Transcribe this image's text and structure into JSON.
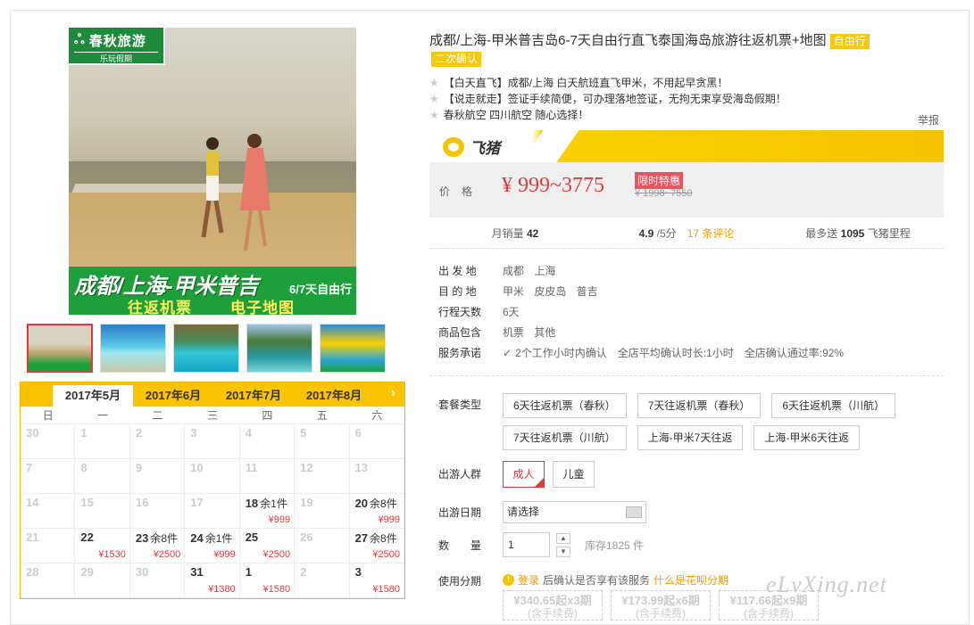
{
  "title": "成都/上海-甲米普吉岛6-7天自由行直飞泰国海岛旅游往返机票+地图",
  "tag_free": "自由行",
  "tag_confirm": "二次确认",
  "features": [
    "【白天直飞】成都/上海 白天航班直飞甲米，不用起早贪黑！",
    "【说走就走】签证手续简便，可办理落地签证，无拘无束享受海岛假期！",
    "春秋航空 四川航空 随心选择！"
  ],
  "report": "举报",
  "fliggy": "飞猪",
  "image": {
    "logo_name": "春秋旅游",
    "logo_sub": "乐玩假期",
    "line1": "成都/上海-甲米普吉",
    "line1_suffix": "6/7天自由行",
    "line2": "往返机票",
    "line3": "电子地图"
  },
  "price": {
    "label": "价格",
    "value": "¥ 999~3775",
    "sale": "限时特惠",
    "original": "¥ 1998~7550"
  },
  "stats": {
    "sales_label": "月销量",
    "sales": "42",
    "rating": "4.9",
    "rating_suffix": "/5分",
    "reviews": "17 条评论",
    "miles_label": "最多送",
    "miles": "1095",
    "miles_suffix": "飞猪里程"
  },
  "info": [
    {
      "k": "出 发 地",
      "v": "成都 上海"
    },
    {
      "k": "目 的 地",
      "v": "甲米 皮皮岛 普吉"
    },
    {
      "k": "行程天数",
      "v": "6天"
    },
    {
      "k": "商品包含",
      "v": "机票 其他"
    }
  ],
  "service": {
    "k": "服务承诺",
    "v": "2个工作小时内确认　全店平均确认时长:1小时　全店确认通过率:92%"
  },
  "package_label": "套餐类型",
  "packages": [
    "6天往返机票（春秋）",
    "7天往返机票（春秋）",
    "6天往返机票（川航）",
    "7天往返机票（川航）",
    "上海-甲米7天往返",
    "上海-甲米6天往返"
  ],
  "group_label": "出游人群",
  "groups": [
    "成人",
    "儿童"
  ],
  "date_label": "出游日期",
  "date_placeholder": "请选择",
  "qty_label": "数　量",
  "qty": "1",
  "stock": "库存1825 件",
  "inst_label": "使用分期",
  "inst": {
    "login": "登录",
    "text": "后确认是否享有该服务",
    "link": "什么是花呗分期"
  },
  "inst_boxes": [
    {
      "a": "¥340.65起x3期",
      "b": "(含手续费)"
    },
    {
      "a": "¥173.99起x6期",
      "b": "(含手续费)"
    },
    {
      "a": "¥117.66起x9期",
      "b": "(含手续费)"
    }
  ],
  "watermark": "eLvXing.net",
  "calendar": {
    "months": [
      "2017年5月",
      "2017年6月",
      "2017年7月",
      "2017年8月"
    ],
    "weekdays": [
      "日",
      "一",
      "二",
      "三",
      "四",
      "五",
      "六"
    ],
    "cells": [
      {
        "d": "30"
      },
      {
        "d": "1"
      },
      {
        "d": "2"
      },
      {
        "d": "3"
      },
      {
        "d": "4"
      },
      {
        "d": "5"
      },
      {
        "d": "6"
      },
      {
        "d": "7"
      },
      {
        "d": "8"
      },
      {
        "d": "9"
      },
      {
        "d": "10"
      },
      {
        "d": "11"
      },
      {
        "d": "12"
      },
      {
        "d": "13"
      },
      {
        "d": "14"
      },
      {
        "d": "15"
      },
      {
        "d": "16"
      },
      {
        "d": "17"
      },
      {
        "d": "18",
        "s": "余1件",
        "p": "¥999"
      },
      {
        "d": "19"
      },
      {
        "d": "20",
        "s": "余8件",
        "p": "¥999"
      },
      {
        "d": "21"
      },
      {
        "d": "22",
        "p": "¥1530"
      },
      {
        "d": "23",
        "s": "余8件",
        "p": "¥2500"
      },
      {
        "d": "24",
        "s": "余1件",
        "p": "¥999"
      },
      {
        "d": "25",
        "p": "¥2500"
      },
      {
        "d": "26"
      },
      {
        "d": "27",
        "s": "余8件",
        "p": "¥2500"
      },
      {
        "d": "28"
      },
      {
        "d": "29"
      },
      {
        "d": "30"
      },
      {
        "d": "31",
        "p": "¥1380"
      },
      {
        "d": "1",
        "p": "¥1580"
      },
      {
        "d": "2"
      },
      {
        "d": "3",
        "p": "¥1580"
      }
    ]
  },
  "colors": {
    "accent": "#e4393c",
    "yellow": "#fbc400",
    "orange": "#f29900"
  }
}
